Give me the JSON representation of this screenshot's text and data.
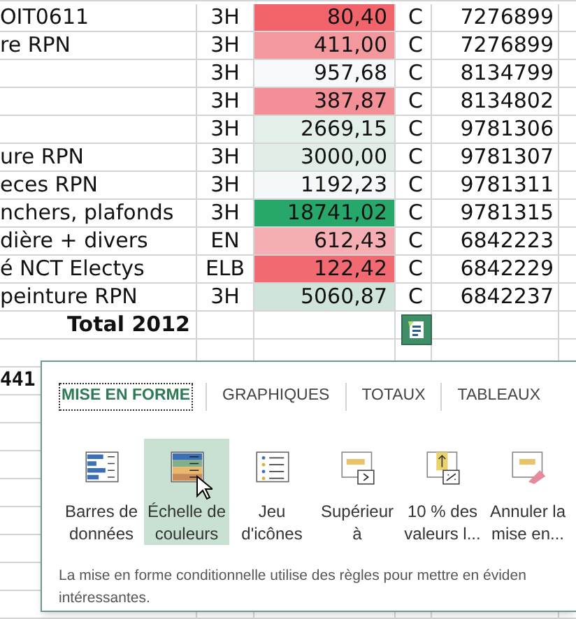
{
  "sheet": {
    "rows": [
      {
        "col_a": "OIT0611",
        "col_b": "3H",
        "value": "80,40",
        "color": "#f2646c",
        "col_d": "C",
        "col_e": "7276899"
      },
      {
        "col_a": "re RPN",
        "col_b": "3H",
        "value": "411,00",
        "color": "#f3999e",
        "col_d": "C",
        "col_e": "7276899"
      },
      {
        "col_b": "3H",
        "value": "957,68",
        "color": "#f8f9fb",
        "col_d": "C",
        "col_e": "8134799"
      },
      {
        "col_b": "3H",
        "value": "387,87",
        "color": "#f39097",
        "col_d": "C",
        "col_e": "8134802"
      },
      {
        "col_b": "3H",
        "value": "2669,15",
        "color": "#e3efe9",
        "col_d": "C",
        "col_e": "9781306"
      },
      {
        "col_a": "ure RPN",
        "col_b": "3H",
        "value": "3000,00",
        "color": "#e1eee7",
        "col_d": "C",
        "col_e": "9781307"
      },
      {
        "col_a": "eces RPN",
        "col_b": "3H",
        "value": "1192,23",
        "color": "#f5f8f8",
        "col_d": "C",
        "col_e": "9781311"
      },
      {
        "col_a": "nchers, plafonds",
        "col_b": "3H",
        "value": "18741,02",
        "color": "#27a86a",
        "col_d": "C",
        "col_e": "9781315"
      },
      {
        "col_a": "dière + divers",
        "col_b": "EN",
        "value": "612,43",
        "color": "#f5aeb3",
        "col_d": "C",
        "col_e": "6842223"
      },
      {
        "col_a": "é NCT Electys",
        "col_b": "ELB",
        "value": "122,42",
        "color": "#f26a71",
        "col_d": "C",
        "col_e": "6842229"
      },
      {
        "col_a": "peinture RPN",
        "col_b": "3H",
        "value": "5060,87",
        "color": "#cfe5da",
        "col_d": "C",
        "col_e": "6842237"
      }
    ],
    "total_label": "Total 2012",
    "below_text": "441"
  },
  "quick_analysis": {
    "tabs": [
      {
        "label": "MISE EN FORME",
        "selected": true
      },
      {
        "label": "GRAPHIQUES",
        "selected": false
      },
      {
        "label": "TOTAUX",
        "selected": false
      },
      {
        "label": "TABLEAUX",
        "selected": false
      }
    ],
    "tools": [
      {
        "kind": "bars",
        "label": "Barres de données",
        "selected": false
      },
      {
        "kind": "scale",
        "label": "Échelle de couleurs",
        "selected": true
      },
      {
        "kind": "icons",
        "label": "Jeu d'icônes",
        "selected": false
      },
      {
        "kind": "greater",
        "label": "Supérieur à",
        "selected": false
      },
      {
        "kind": "top",
        "label": "10 % des valeurs l...",
        "selected": false
      },
      {
        "kind": "clear",
        "label": "Annuler la mise en...",
        "selected": false
      }
    ],
    "description_lines": [
      "La mise en forme conditionnelle utilise des règles pour mettre en éviden",
      "intéressantes."
    ]
  }
}
